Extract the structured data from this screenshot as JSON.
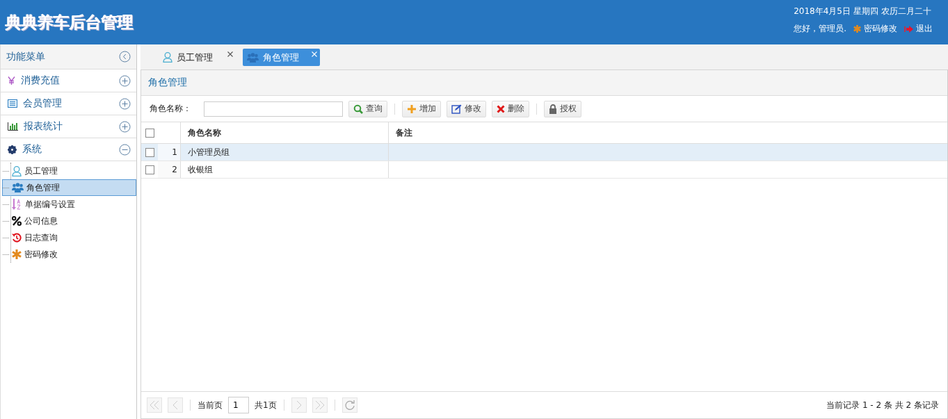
{
  "header": {
    "title": "典典养车后台管理",
    "date": "2018年4月5日 星期四 农历二月二十",
    "greeting": "您好，管理员.",
    "links": [
      {
        "label": "密码修改"
      },
      {
        "label": "退出"
      }
    ]
  },
  "sidebar": {
    "title": "功能菜单",
    "groups": [
      {
        "label": "消费充值",
        "expanded": false
      },
      {
        "label": "会员管理",
        "expanded": false
      },
      {
        "label": "报表统计",
        "expanded": false
      },
      {
        "label": "系统",
        "expanded": true,
        "children": [
          {
            "label": "员工管理",
            "selected": false
          },
          {
            "label": "角色管理",
            "selected": true
          },
          {
            "label": "单据编号设置",
            "selected": false
          },
          {
            "label": "公司信息",
            "selected": false
          },
          {
            "label": "日志查询",
            "selected": false
          },
          {
            "label": "密码修改",
            "selected": false
          }
        ]
      }
    ]
  },
  "tabs": [
    {
      "label": "员工管理",
      "selected": false
    },
    {
      "label": "角色管理",
      "selected": true
    }
  ],
  "panel": {
    "title": "角色管理",
    "search_label": "角色名称：",
    "buttons": [
      {
        "label": "查询"
      },
      {
        "label": "增加"
      },
      {
        "label": "修改"
      },
      {
        "label": "删除"
      },
      {
        "label": "授权"
      }
    ],
    "table": {
      "select_all_checked": false,
      "columns": [
        "角色名称",
        "备注"
      ],
      "rows": [
        {
          "index": "1",
          "name": "小管理员组",
          "selected": true,
          "checked": false
        },
        {
          "index": "2",
          "name": "收银组",
          "selected": false,
          "checked": false
        }
      ]
    },
    "pager": {
      "current_label": "当前页",
      "page": "1",
      "total": "共1页",
      "summary": "当前记录 1 - 2 条 共 2 条记录"
    }
  }
}
